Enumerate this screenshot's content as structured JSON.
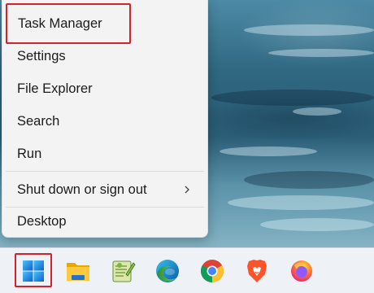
{
  "context_menu": {
    "items": [
      {
        "label": "Task Manager",
        "highlighted": true
      },
      {
        "label": "Settings"
      },
      {
        "label": "File Explorer"
      },
      {
        "label": "Search"
      },
      {
        "label": "Run"
      },
      {
        "label": "Shut down or sign out",
        "has_submenu": true
      },
      {
        "label": "Desktop"
      }
    ]
  },
  "taskbar": {
    "apps": [
      {
        "name": "windows-start-icon",
        "highlighted": true
      },
      {
        "name": "file-explorer-icon"
      },
      {
        "name": "notepad-plus-plus-icon"
      },
      {
        "name": "edge-icon"
      },
      {
        "name": "chrome-icon"
      },
      {
        "name": "brave-icon"
      },
      {
        "name": "firefox-icon"
      }
    ]
  },
  "colors": {
    "highlight_border": "#d6202a",
    "menu_bg": "#f3f3f3",
    "taskbar_bg": "#eef1f6",
    "windows_blue": "#1e88e5"
  }
}
